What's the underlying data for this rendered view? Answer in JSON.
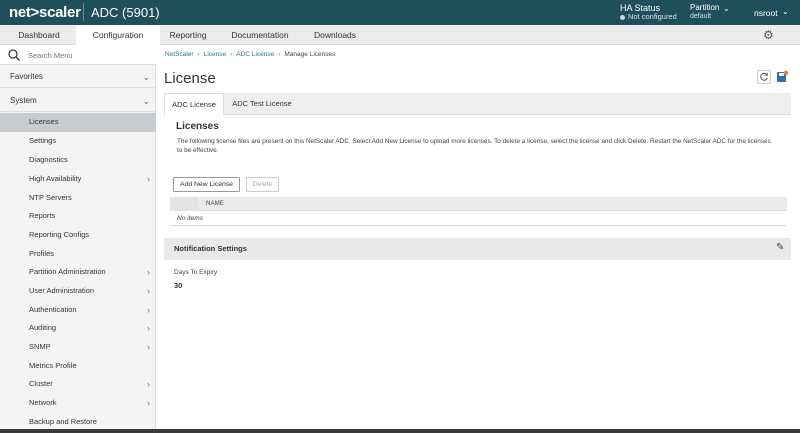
{
  "topbar": {
    "logo": "net>scaler",
    "app_title": "ADC (5901)",
    "ha_status_label": "HA Status",
    "ha_status_value": "Not configured",
    "partition_label": "Partition",
    "partition_value": "default",
    "user": "nsroot",
    "colors": {
      "bar": "#1f4f5a"
    }
  },
  "nav_tabs": [
    "Dashboard",
    "Configuration",
    "Reporting",
    "Documentation",
    "Downloads"
  ],
  "nav_active": "Configuration",
  "sidebar": {
    "search_placeholder": "Search Menu",
    "favorites": "Favorites",
    "system": "System",
    "items": [
      "Licenses",
      "Settings",
      "Diagnostics",
      "High Availability",
      "NTP Servers",
      "Reports",
      "Reporting Configs",
      "Profiles",
      "Partition Administration",
      "User Administration",
      "Authentication",
      "Auditing",
      "SNMP",
      "Metrics Profile",
      "Cluster",
      "Network",
      "Backup and Restore"
    ],
    "active_item": "Licenses"
  },
  "breadcrumb": [
    "NetScaler",
    "License",
    "ADC License",
    "Manage Licenses"
  ],
  "page_title": "License",
  "license_tabs": [
    "ADC License",
    "ADC Test License"
  ],
  "licenses": {
    "heading": "Licenses",
    "description": "The following license files are present on this NetScaler ADC. Select Add New License to upload more licenses. To delete a license, select the license and click Delete. Restart the NetScaler ADC for the licenses to be effective.",
    "add_button": "Add New License",
    "delete_button": "Delete",
    "column_name": "NAME",
    "empty_text": "No items"
  },
  "notification": {
    "title": "Notification Settings",
    "days_label": "Days To Expiry",
    "days_value": "30"
  }
}
